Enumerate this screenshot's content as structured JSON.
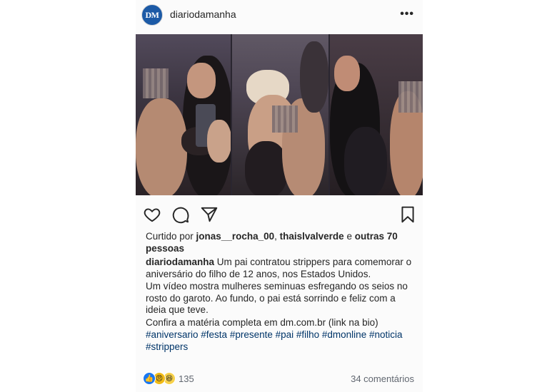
{
  "header": {
    "avatar_text": "DM",
    "username": "diariodamanha",
    "more_icon": "more-options-icon"
  },
  "photos": {
    "description_icons": [
      "photo-1",
      "photo-2",
      "photo-3"
    ]
  },
  "actions": {
    "icons": [
      "heart-icon",
      "comment-icon",
      "share-icon",
      "bookmark-icon"
    ]
  },
  "likes": {
    "prefix": "Curtido por ",
    "user1": "jonas__rocha_00",
    "sep": ", ",
    "user2": "thaislvalverde",
    "suffix_pre": " e ",
    "others": "outras 70 pessoas"
  },
  "caption": {
    "username": "diariodamanha",
    "line1": " Um pai contratou strippers para comemorar o aniversário do filho de 12 anos, nos Estados Unidos.",
    "line2": "Um vídeo mostra mulheres seminuas esfregando os seios no rosto do garoto. Ao fundo, o pai está sorrindo e feliz com a ideia que teve.",
    "line3": "Confira a matéria completa em dm.com.br (link na bio)",
    "hashtags": "#aniversario #festa #presente #pai #filho #dmonline #noticia #strippers"
  },
  "footer": {
    "reaction_count": "135",
    "comments": "34 comentários"
  },
  "colors": {
    "brand_blue": "#1c5aa6",
    "like_blue": "#1877f2",
    "hashtag": "#003569"
  }
}
